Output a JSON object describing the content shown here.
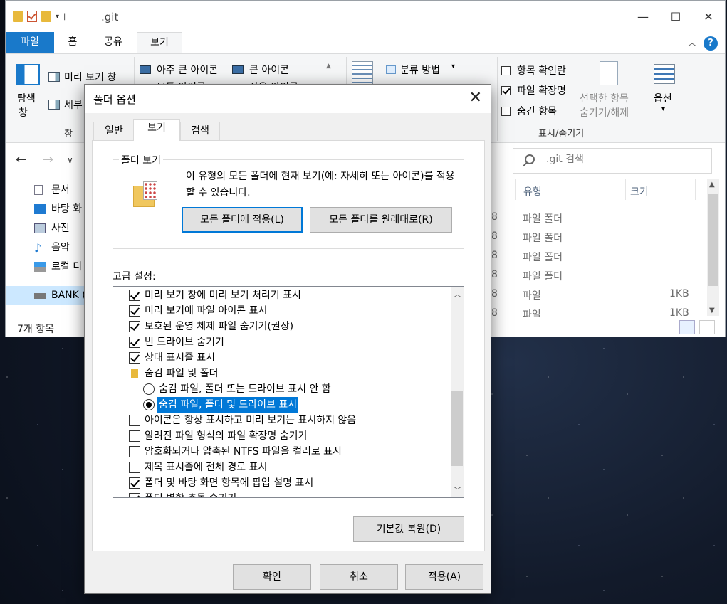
{
  "explorer": {
    "title": ".git",
    "tabs": [
      "파일",
      "홈",
      "공유",
      "보기"
    ],
    "ribbon": {
      "nav_pane": [
        "탐색",
        "창"
      ],
      "preview_pane": "미리 보기 창",
      "details_pane": "세부",
      "layout_items": [
        "아주 큰 아이콘",
        "큰 아이콘",
        "보통 아이콘",
        "작은 아이콘"
      ],
      "sort_by": "분류 방법",
      "checkbox_items": {
        "item_check": "항목 확인란",
        "file_ext": "파일 확장명",
        "hidden": "숨긴 항목"
      },
      "hide_selected": [
        "선택한 항목",
        "숨기기/해제"
      ],
      "options": "옵션",
      "group_pane": "창",
      "group_showhide": "표시/숨기기"
    },
    "search_placeholder": ".git 검색",
    "nav_items": [
      "문서",
      "바탕 화",
      "사진",
      "음악",
      "로컬 디",
      "BANK ("
    ],
    "columns": {
      "type": "유형",
      "size": "크기"
    },
    "rows": [
      {
        "date_suffix": "8",
        "type": "파일 폴더",
        "size": ""
      },
      {
        "date_suffix": "8",
        "type": "파일 폴더",
        "size": ""
      },
      {
        "date_suffix": "8",
        "type": "파일 폴더",
        "size": ""
      },
      {
        "date_suffix": "8",
        "type": "파일 폴더",
        "size": ""
      },
      {
        "date_suffix": "8",
        "type": "파일",
        "size": "1KB"
      },
      {
        "date_suffix": "8",
        "type": "파일",
        "size": "1KB"
      }
    ],
    "status_count": "7개 항목"
  },
  "dialog": {
    "title": "폴더 옵션",
    "tabs": [
      "일반",
      "보기",
      "검색"
    ],
    "folder_view": {
      "legend": "폴더 보기",
      "description": "이 유형의 모든 폴더에 현재 보기(예: 자세히 또는 아이콘)를 적용할 수 있습니다.",
      "apply_button": "모든 폴더에 적용(L)",
      "reset_button": "모든 폴더를 원래대로(R)"
    },
    "advanced_label": "고급 설정:",
    "advanced_items": [
      "미리 보기 창에 미리 보기 처리기 표시",
      "미리 보기에 파일 아이콘 표시",
      "보호된 운영 체제 파일 숨기기(권장)",
      "빈 드라이브 숨기기",
      "상태 표시줄 표시",
      "숨김 파일 및 폴더",
      "숨김 파일, 폴더 또는 드라이브 표시 안 함",
      "숨김 파일, 폴더 및 드라이브 표시",
      "아이콘은 항상 표시하고 미리 보기는 표시하지 않음",
      "알려진 파일 형식의 파일 확장명 숨기기",
      "암호화되거나 압축된 NTFS 파일을 컬러로 표시",
      "제목 표시줄에 전체 경로 표시",
      "폴더 및 바탕 화면 항목에 팝업 설명 표시",
      "폴더 병합 충돌 숨기기"
    ],
    "restore_button": "기본값 복원(D)",
    "ok_button": "확인",
    "cancel_button": "취소",
    "apply_button": "적용(A)"
  },
  "colors": {
    "accent": "#0078d7",
    "file_tab": "#1979ca",
    "folder": "#e8b93c"
  }
}
